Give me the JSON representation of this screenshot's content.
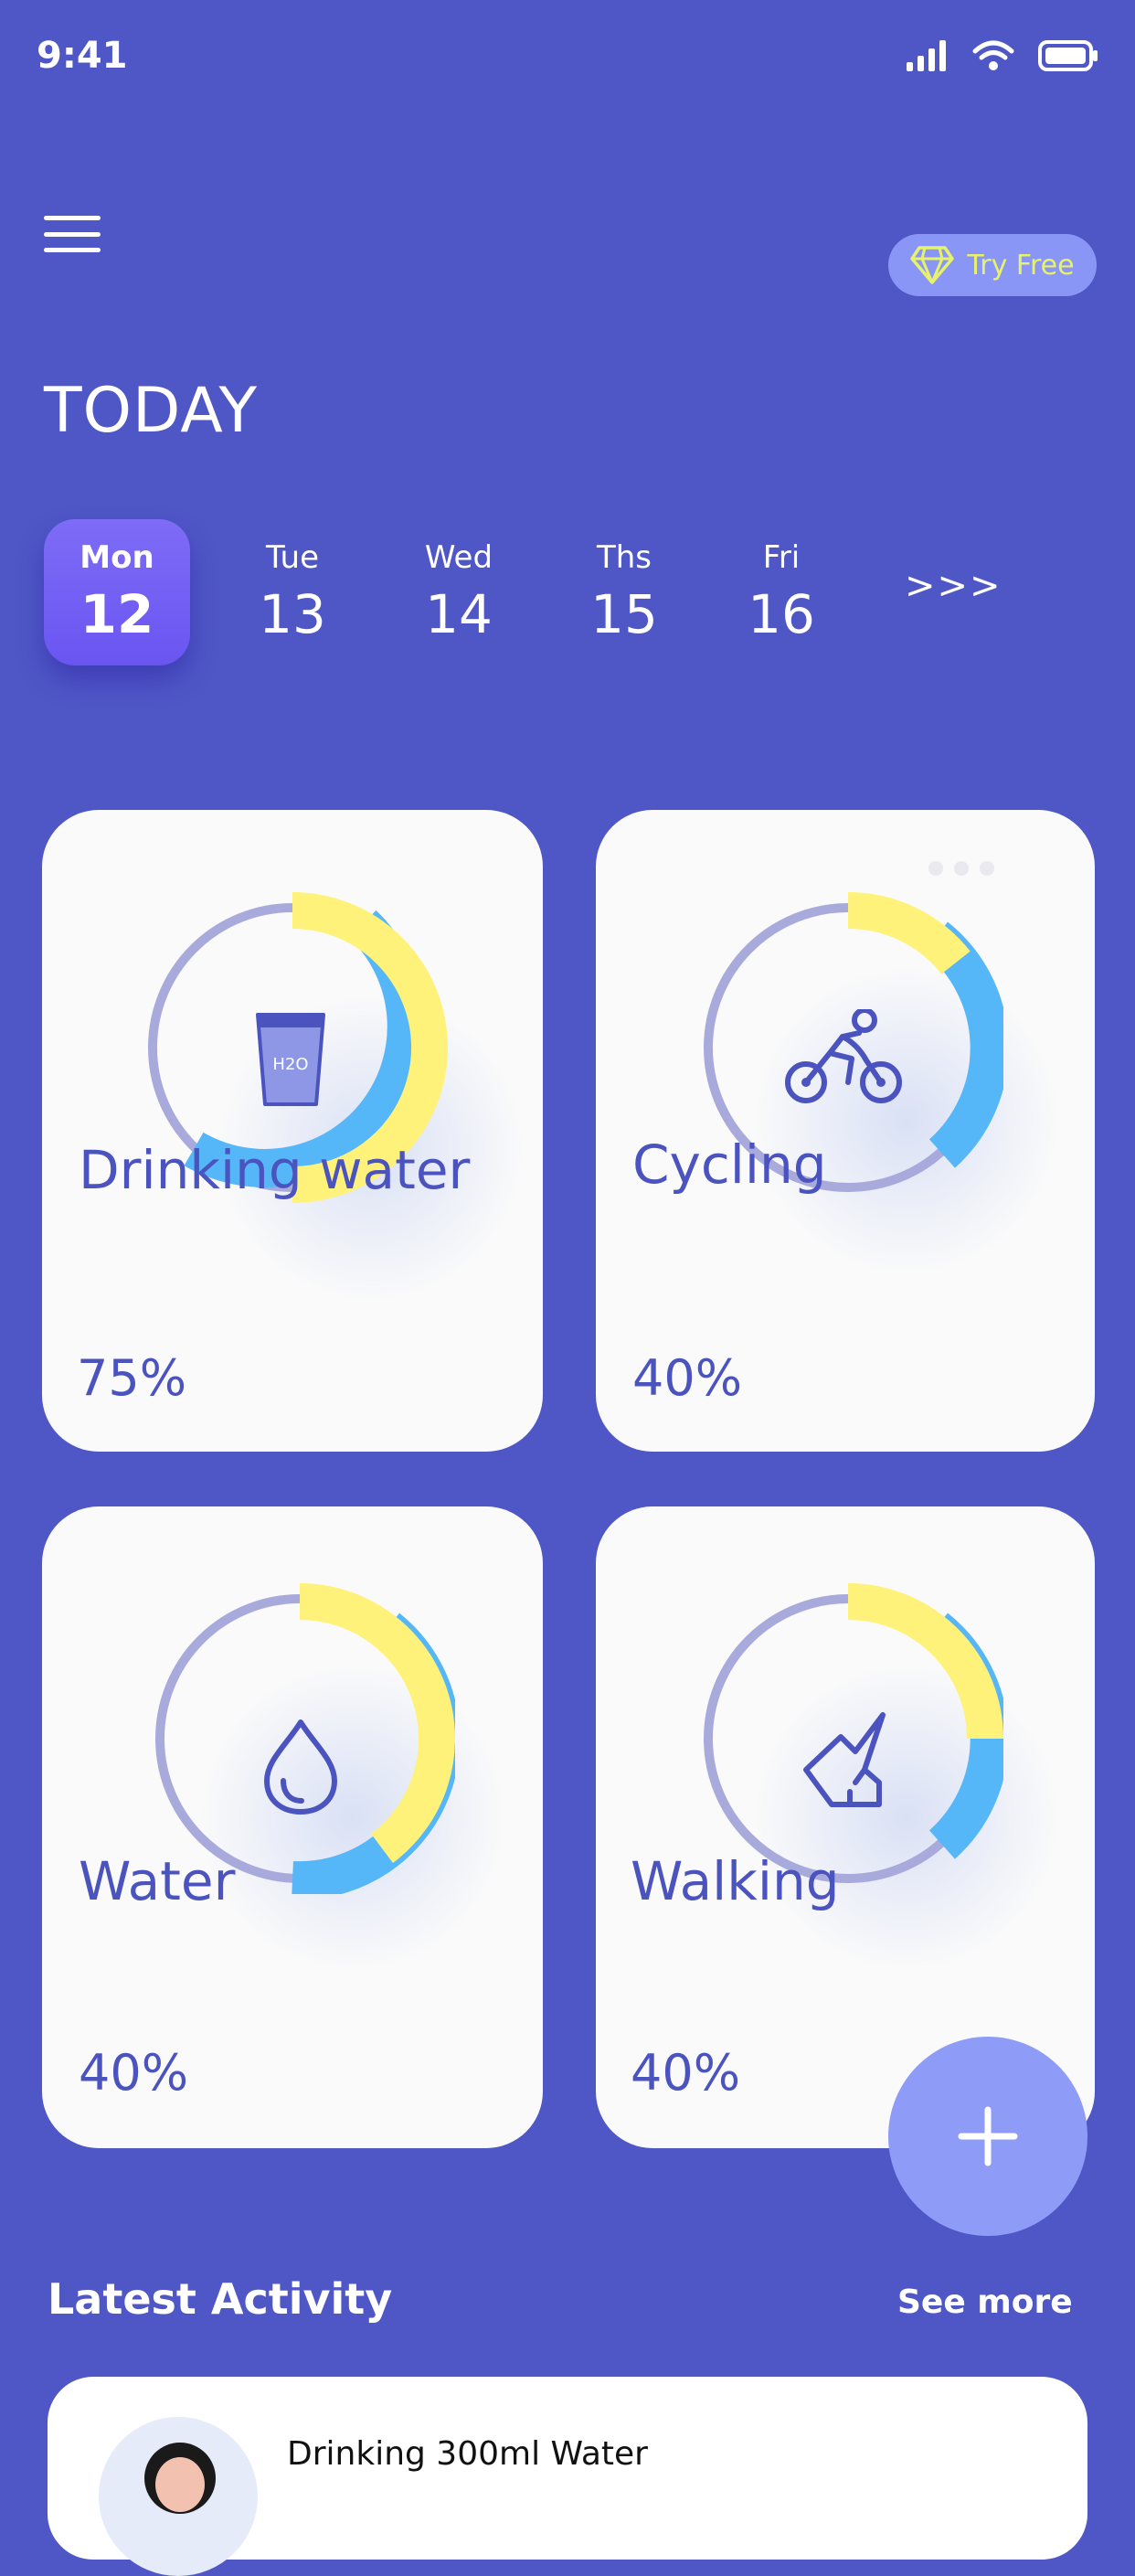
{
  "status_bar": {
    "time": "9:41"
  },
  "header": {
    "try_free_label": "Try Free",
    "title": "TODAY"
  },
  "days": [
    {
      "name": "Mon",
      "date": "12",
      "active": true
    },
    {
      "name": "Tue",
      "date": "13",
      "active": false
    },
    {
      "name": "Wed",
      "date": "14",
      "active": false
    },
    {
      "name": "Ths",
      "date": "15",
      "active": false
    },
    {
      "name": "Fri",
      "date": "16",
      "active": false
    }
  ],
  "more_days_label": ">>>",
  "cards": [
    {
      "title": "Drinking water",
      "percent": "75%",
      "icon": "water-glass-icon"
    },
    {
      "title": "Cycling",
      "percent": "40%",
      "icon": "bicycle-icon"
    },
    {
      "title": "Water",
      "percent": "40%",
      "icon": "water-drop-icon"
    },
    {
      "title": "Walking",
      "percent": "40%",
      "icon": "sneaker-icon"
    }
  ],
  "latest_activity": {
    "heading": "Latest Activity",
    "see_more_label": "See more",
    "items": [
      {
        "text": "Drinking 300ml Water"
      }
    ]
  },
  "colors": {
    "background": "#4F57C6",
    "card": "#FAFAFA",
    "ring_track": "#A8AADC",
    "ring_yellow": "#FFF27A",
    "ring_blue": "#55B6F8",
    "accent_text": "#4B53BE",
    "fab": "#8E9CF7",
    "try_free_bg": "#8A96F6",
    "try_free_text": "#E6F26A"
  }
}
